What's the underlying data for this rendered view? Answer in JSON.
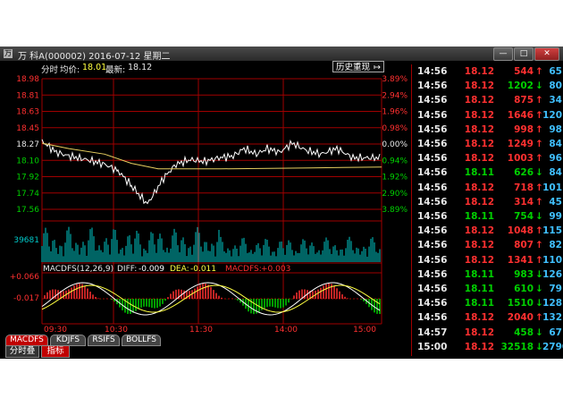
{
  "window": {
    "title": "万 科A(000002) 2016-07-12 星期二",
    "icon_glyph": "万"
  },
  "header": {
    "label_timeshare": "分时",
    "label_avg": "均价:",
    "avg_value": "18.01",
    "label_last": "最新:",
    "last_value": "18.12",
    "history_button": "历史重现",
    "history_icon": "↦"
  },
  "axes": {
    "left_price": [
      "18.98",
      "18.81",
      "18.63",
      "18.45",
      "18.27",
      "18.10",
      "17.92",
      "17.74",
      "17.56"
    ],
    "right_pct": [
      "3.89%",
      "2.94%",
      "1.96%",
      "0.98%",
      "0.00%",
      "0.94%",
      "1.92%",
      "2.90%",
      "3.89%"
    ],
    "vol_max": "39681",
    "macd_top": "+0.066",
    "macd_low": "-0.017",
    "time_labels": [
      "09:30",
      "10:30",
      "11:30",
      "14:00",
      "15:00"
    ]
  },
  "macd": {
    "label": "MACDFS(12,26,9)",
    "diff_label": "DIFF:",
    "diff_value": "-0.009",
    "dea_label": "DEA:",
    "dea_value": "-0.011",
    "macdfs_label": "MACDFS:",
    "macdfs_value": "+0.003"
  },
  "colors": {
    "up": "#ff3030",
    "down": "#00d000",
    "neutral": "#e8e8e8",
    "grid": "#a00000",
    "price_line": "#ffffff",
    "avg_line": "#e8d060",
    "volume": "#00c8c8",
    "count": "#40c0ff"
  },
  "tabs": [
    "MACDFS",
    "KDJFS",
    "RSIFS",
    "BOLLFS"
  ],
  "tabs_bottom": [
    "分时叠",
    "指标"
  ],
  "ticks": [
    {
      "time": "14:56",
      "price": "18.12",
      "vol": "544",
      "dir": "up",
      "count": "65"
    },
    {
      "time": "14:56",
      "price": "18.12",
      "vol": "1202",
      "dir": "down",
      "count": "80"
    },
    {
      "time": "14:56",
      "price": "18.12",
      "vol": "875",
      "dir": "up",
      "count": "34"
    },
    {
      "time": "14:56",
      "price": "18.12",
      "vol": "1646",
      "dir": "up",
      "count": "120"
    },
    {
      "time": "14:56",
      "price": "18.12",
      "vol": "998",
      "dir": "up",
      "count": "98"
    },
    {
      "time": "14:56",
      "price": "18.12",
      "vol": "1249",
      "dir": "up",
      "count": "84"
    },
    {
      "time": "14:56",
      "price": "18.12",
      "vol": "1003",
      "dir": "up",
      "count": "96"
    },
    {
      "time": "14:56",
      "price": "18.11",
      "vol": "626",
      "dir": "down",
      "count": "84"
    },
    {
      "time": "14:56",
      "price": "18.12",
      "vol": "718",
      "dir": "up",
      "count": "101"
    },
    {
      "time": "14:56",
      "price": "18.12",
      "vol": "314",
      "dir": "up",
      "count": "45"
    },
    {
      "time": "14:56",
      "price": "18.11",
      "vol": "754",
      "dir": "down",
      "count": "99"
    },
    {
      "time": "14:56",
      "price": "18.12",
      "vol": "1048",
      "dir": "up",
      "count": "115"
    },
    {
      "time": "14:56",
      "price": "18.12",
      "vol": "807",
      "dir": "up",
      "count": "82"
    },
    {
      "time": "14:56",
      "price": "18.12",
      "vol": "1341",
      "dir": "up",
      "count": "110"
    },
    {
      "time": "14:56",
      "price": "18.11",
      "vol": "983",
      "dir": "down",
      "count": "126"
    },
    {
      "time": "14:56",
      "price": "18.11",
      "vol": "610",
      "dir": "down",
      "count": "79"
    },
    {
      "time": "14:56",
      "price": "18.11",
      "vol": "1510",
      "dir": "down",
      "count": "128"
    },
    {
      "time": "14:56",
      "price": "18.12",
      "vol": "2040",
      "dir": "up",
      "count": "132"
    },
    {
      "time": "14:57",
      "price": "18.12",
      "vol": "458",
      "dir": "down",
      "count": "67"
    },
    {
      "time": "15:00",
      "price": "18.12",
      "vol": "32518",
      "dir": "down",
      "count": "2790"
    }
  ]
}
